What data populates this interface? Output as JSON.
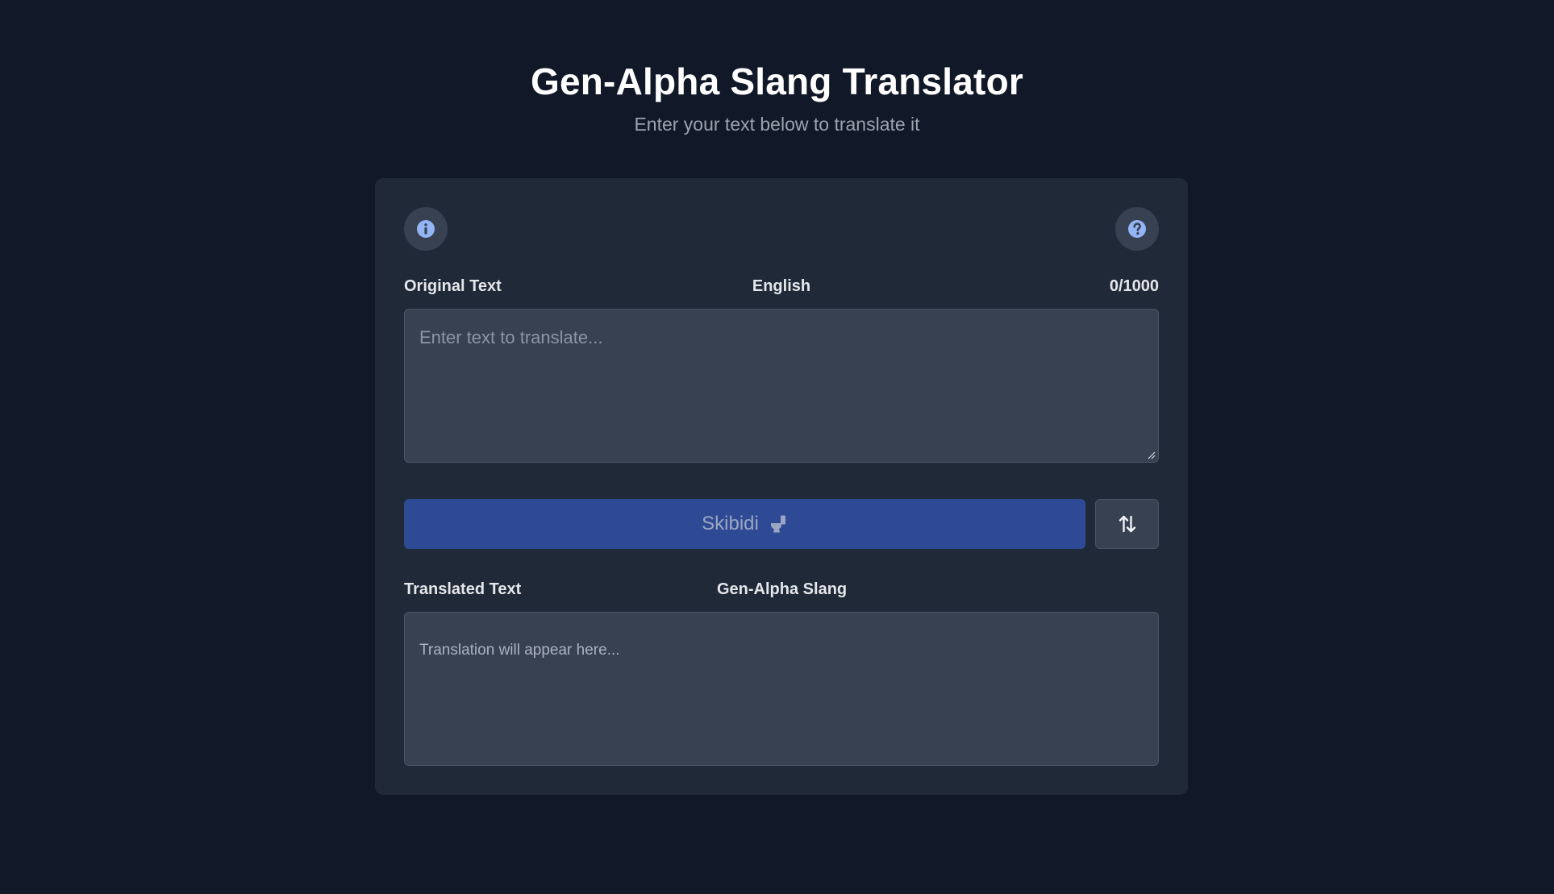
{
  "header": {
    "title": "Gen-Alpha Slang Translator",
    "subtitle": "Enter your text below to translate it"
  },
  "card": {
    "info_icon": "info-icon",
    "help_icon": "question-icon",
    "source": {
      "label": "Original Text",
      "language": "English",
      "char_count": "0/1000",
      "placeholder": "Enter text to translate..."
    },
    "translate_button": {
      "label": "Skibidi",
      "icon": "toilet-icon"
    },
    "swap_button": {
      "icon": "swap-vertical-arrows-icon"
    },
    "target": {
      "label": "Translated Text",
      "language": "Gen-Alpha Slang",
      "placeholder": "Translation will appear here..."
    }
  },
  "colors": {
    "background": "#111827",
    "card": "#1f2937",
    "field": "#374151",
    "button_primary": "#2f4a95",
    "icon_accent": "#93b4f5"
  }
}
